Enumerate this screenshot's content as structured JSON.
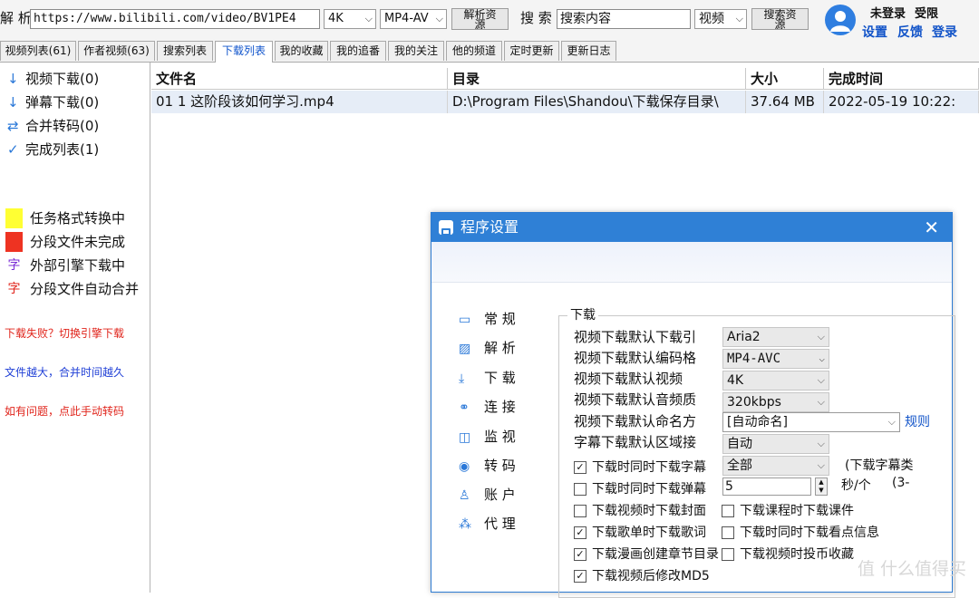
{
  "topbar": {
    "parse_label": "解 析",
    "url_value": "https://www.bilibili.com/video/BV1PE4",
    "quality_value": "4K",
    "format_value": "MP4-AV",
    "parse_button": "解析资源",
    "search_label": "搜 索",
    "search_value": "搜索内容",
    "search_type_value": "视频",
    "search_button": "搜索资源",
    "user_status": "未登录",
    "permission": "受限",
    "settings_link": "设置",
    "feedback_link": "反馈",
    "login_link": "登录"
  },
  "tabs": [
    {
      "label": "视频列表(61)"
    },
    {
      "label": "作者视频(63)"
    },
    {
      "label": "搜索列表"
    },
    {
      "label": "下载列表"
    },
    {
      "label": "我的收藏"
    },
    {
      "label": "我的追番"
    },
    {
      "label": "我的关注"
    },
    {
      "label": "他的频道"
    },
    {
      "label": "定时更新"
    },
    {
      "label": "更新日志"
    }
  ],
  "sidebar": {
    "items": [
      {
        "icon": "download-arrow-icon",
        "label": "视频下载(0)"
      },
      {
        "icon": "download-arrow-icon",
        "label": "弹幕下载(0)"
      },
      {
        "icon": "merge-icon",
        "label": "合并转码(0)"
      },
      {
        "icon": "check-icon",
        "label": "完成列表(1)"
      }
    ],
    "legend": [
      {
        "color": "#ffff33",
        "label": "任务格式转换中"
      },
      {
        "color": "#ee3322",
        "label": "分段文件未完成"
      },
      {
        "label": "外部引擎下载中",
        "glyph": "字"
      },
      {
        "label": "分段文件自动合并",
        "glyph": "字"
      }
    ],
    "tips": [
      {
        "text": "下载失败？切换引擎下载",
        "color": "#e0241b"
      },
      {
        "text": "文件越大，合并时间越久",
        "color": "#1f3fd6"
      },
      {
        "text": "如有问题，点此手动转码",
        "color": "#e0241b"
      }
    ]
  },
  "table": {
    "headers": [
      "文件名",
      "目录",
      "大小",
      "完成时间"
    ],
    "rows": [
      [
        "01 1 这阶段该如何学习.mp4",
        "D:\\Program Files\\Shandou\\下载保存目录\\",
        "37.64 MB",
        "2022-05-19 10:22:"
      ]
    ]
  },
  "dialog": {
    "title": "程序设置",
    "nav": [
      {
        "label": "常 规",
        "icon": "monitor-icon"
      },
      {
        "label": "解 析",
        "icon": "image-icon"
      },
      {
        "label": "下 载",
        "icon": "download-box-icon"
      },
      {
        "label": "连 接",
        "icon": "link-icon"
      },
      {
        "label": "监 视",
        "icon": "monitor-watch-icon"
      },
      {
        "label": "转 码",
        "icon": "transcode-icon"
      },
      {
        "label": "账 户",
        "icon": "user-icon"
      },
      {
        "label": "代 理",
        "icon": "proxy-icon"
      }
    ],
    "section_title": "下载",
    "settings": [
      {
        "label": "视频下载默认下载引",
        "value": "Aria2"
      },
      {
        "label": "视频下载默认编码格",
        "value": "MP4-AVC"
      },
      {
        "label": "视频下载默认视频",
        "value": "4K"
      },
      {
        "label": "视频下载默认音频质",
        "value": "320kbps"
      },
      {
        "label": "视频下载默认命名方",
        "value": "[自动命名]"
      },
      {
        "label": "字幕下载默认区域接",
        "value": "自动"
      }
    ],
    "rule_link": "规则",
    "checkboxes_left": [
      {
        "label": "下载时同时下载字幕",
        "checked": true
      },
      {
        "label": "下载时同时下载弹幕",
        "checked": false
      },
      {
        "label": "下载视频时下载封面",
        "checked": false
      },
      {
        "label": "下载歌单时下载歌词",
        "checked": true
      },
      {
        "label": "下载漫画创建章节目录",
        "checked": true
      },
      {
        "label": "下载视频后修改MD5",
        "checked": true
      }
    ],
    "subtitle_range": "全部",
    "subtitle_range_note": "(下载字幕类",
    "interval_value": "5",
    "interval_unit": "秒/个",
    "interval_note": "(3-",
    "checkboxes_right": [
      {
        "label": "下载课程时下载课件",
        "checked": false
      },
      {
        "label": "下载时同时下载看点信息",
        "checked": false
      },
      {
        "label": "下载视频时投币收藏",
        "checked": false
      }
    ]
  },
  "watermark": "值 什么值得买"
}
